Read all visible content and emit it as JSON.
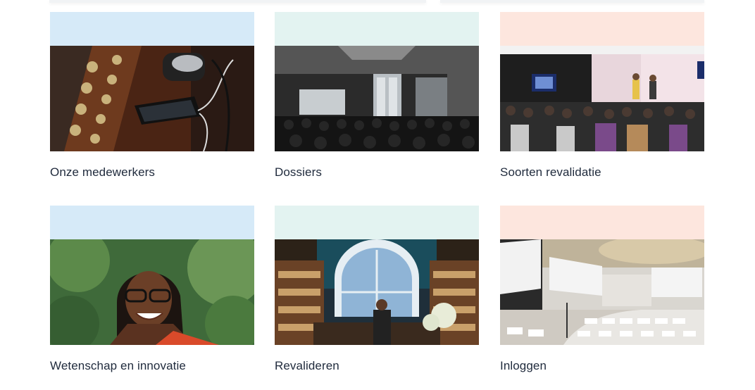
{
  "cards": [
    {
      "label": "Onze medewerkers",
      "band_color": "#d6eaf8",
      "image": "phone-on-audio-mixer-photo"
    },
    {
      "label": "Dossiers",
      "band_color": "#e3f3f1",
      "image": "conference-hall-audience-photo"
    },
    {
      "label": "Soorten revalidatie",
      "band_color": "#fde6de",
      "image": "presentation-stage-audience-photo"
    },
    {
      "label": "Wetenschap en innovatie",
      "band_color": "#d6eaf8",
      "image": "smiling-woman-portrait-photo"
    },
    {
      "label": "Revalideren",
      "band_color": "#e3f3f1",
      "image": "bookstore-interior-photo"
    },
    {
      "label": "Inloggen",
      "band_color": "#fde6de",
      "image": "lecture-auditorium-photo"
    }
  ]
}
